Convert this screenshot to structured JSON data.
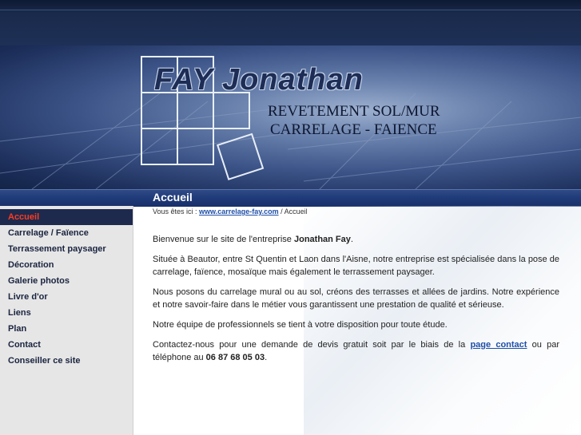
{
  "header": {
    "logo_title": "FAY Jonathan",
    "tagline_1": "REVETEMENT SOL/MUR",
    "tagline_2": "CARRELAGE - FAIENCE"
  },
  "page_title": "Accueil",
  "breadcrumb": {
    "prefix": "Vous êtes ici :",
    "link_text": "www.carrelage-fay.com",
    "separator": "/",
    "current": "Accueil"
  },
  "sidebar": {
    "items": [
      {
        "label": "Accueil",
        "active": true
      },
      {
        "label": "Carrelage / Faïence"
      },
      {
        "label": "Terrassement paysager"
      },
      {
        "label": "Décoration"
      },
      {
        "label": "Galerie photos"
      },
      {
        "label": "Livre d'or"
      },
      {
        "label": "Liens"
      },
      {
        "label": "Plan"
      },
      {
        "label": "Contact"
      },
      {
        "label": "Conseiller ce site"
      }
    ]
  },
  "content": {
    "p1_text": "Bienvenue sur le site de l'entreprise ",
    "p1_bold": "Jonathan Fay",
    "p1_end": ".",
    "p2": "Située à Beautor, entre St Quentin et Laon dans l'Aisne, notre entreprise est spécialisée dans la pose de carrelage, faïence, mosaïque mais également le terrassement paysager.",
    "p3": "Nous posons du carrelage mural ou au sol, créons des terrasses et allées de jardins. Notre expérience et notre savoir-faire dans le métier vous garantissent une prestation de qualité et sérieuse.",
    "p4": "Notre équipe de professionnels se tient à votre disposition pour toute étude.",
    "p5_start": "Contactez-nous pour une demande de devis gratuit soit par le biais de la ",
    "p5_link": "page contact",
    "p5_mid": " ou par téléphone au ",
    "p5_phone": "06 87 68 05 03",
    "p5_end": "."
  },
  "colors": {
    "accent_active": "#ff3b1f",
    "nav_active_bg": "#1d2a4e",
    "link": "#1f4fa8"
  }
}
